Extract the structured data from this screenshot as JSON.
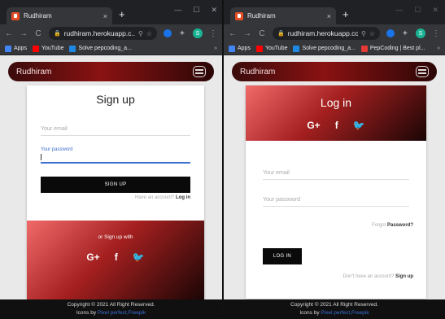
{
  "left_window": {
    "tab_title": "Rudhiram",
    "tab_close": "×",
    "new_tab": "+",
    "window_controls": [
      "—",
      "☐",
      "✕"
    ],
    "url": "rudhiram.herokuapp.c...",
    "bookmarks": [
      {
        "label": "Apps",
        "color": "#4285f4"
      },
      {
        "label": "YouTube",
        "color": "#ff0000"
      },
      {
        "label": "Solve pepcoding_a...",
        "color": "#1e88e5"
      }
    ],
    "bookmarks_more": "»",
    "app": {
      "brand": "Rudhiram",
      "card": {
        "title": "Sign up",
        "email_placeholder": "Your email",
        "password_label": "Your password",
        "submit_label": "SIGN UP",
        "have_account_text": "Have an account? ",
        "login_link": "Log in",
        "or_signup_with": "or Sign up with",
        "social": [
          "G+",
          "f",
          "🐦"
        ]
      },
      "footer": {
        "copyright": "Copyright © 2021 All Right Reserved.",
        "icons_by": "Icons by ",
        "icons_link": "Pixel perfect,Freepik"
      }
    }
  },
  "right_window": {
    "tab_title": "Rudhiram",
    "tab_close": "×",
    "new_tab": "+",
    "window_controls": [
      "—",
      "☐",
      "✕"
    ],
    "url": "rudhiram.herokuapp.co...",
    "bookmarks": [
      {
        "label": "Apps",
        "color": "#4285f4"
      },
      {
        "label": "YouTube",
        "color": "#ff0000"
      },
      {
        "label": "Solve pepcoding_a...",
        "color": "#1e88e5"
      },
      {
        "label": "PepCoding | Best pl...",
        "color": "#e53935"
      }
    ],
    "bookmarks_more": "»",
    "app": {
      "brand": "Rudhiram",
      "card": {
        "title": "Log in",
        "social": [
          "G+",
          "f",
          "🐦"
        ],
        "email_placeholder": "Your email",
        "password_placeholder": "Your password",
        "forgot_text": "Forgot ",
        "forgot_link": "Password?",
        "submit_label": "LOG IN",
        "no_account_text": "Don't have an account? ",
        "signup_link": "Sign up"
      },
      "footer": {
        "copyright": "Copyright © 2021 All Right Reserved.",
        "icons_by": "Icons by ",
        "icons_link": "Pixel perfect,Freepik"
      }
    }
  },
  "colors": {
    "accent_link": "#3b6fd6",
    "focus_underline": "#3f6fd0",
    "brand_dark": "#3a0b0b",
    "brand_red": "#8a1212"
  }
}
